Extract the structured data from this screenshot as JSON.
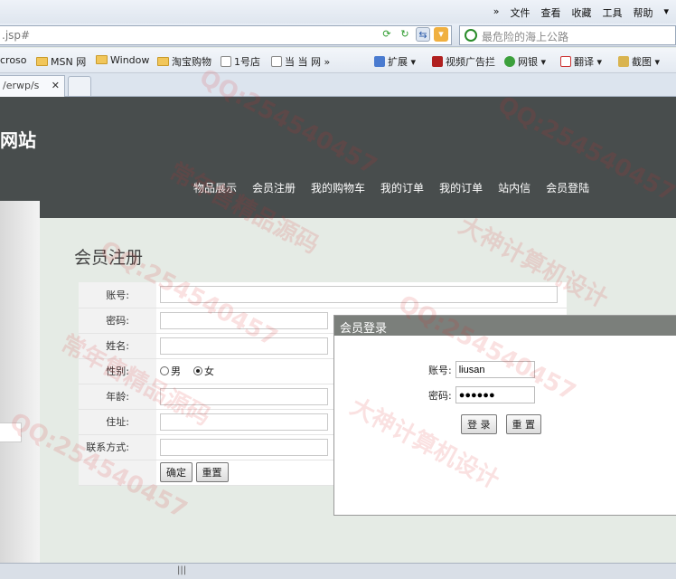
{
  "browser": {
    "menu": [
      "»",
      "文件",
      "查看",
      "收藏",
      "工具",
      "帮助"
    ],
    "url": ".jsp#",
    "search_placeholder": "最危险的海上公路",
    "favorites": [
      "crosо",
      "MSN 网",
      "Window",
      "淘宝购物",
      "1号店",
      "当 当 网 »"
    ],
    "favorites_tools": [
      "扩展 ▾",
      "视频广告拦",
      "网银 ▾",
      "翻译 ▾",
      "截图 ▾"
    ],
    "tab_title": "/erwp/s",
    "tab_close": "✕"
  },
  "site": {
    "title": "网站",
    "nav": [
      "物品展示",
      "会员注册",
      "我的购物车",
      "我的订单",
      "我的订单",
      "站内信",
      "会员登陆"
    ]
  },
  "register": {
    "heading": "会员注册",
    "fields": {
      "account": "账号:",
      "password": "密码:",
      "name": "姓名:",
      "gender": "性别:",
      "age": "年龄:",
      "address": "住址:",
      "contact": "联系方式:"
    },
    "gender_options": {
      "male": "男",
      "female": "女"
    },
    "gender_selected": "女",
    "submit": "确定",
    "reset": "重置"
  },
  "login": {
    "title": "会员登录",
    "account_label": "账号:",
    "account_value": "liusan",
    "password_label": "密码:",
    "password_value": "●●●●●●",
    "login_button": "登 录",
    "reset_button": "重 置"
  },
  "status": {
    "grip": "|||"
  },
  "watermark": {
    "phrases": [
      "常年售精品源码",
      "QQ:254540457",
      "大神计算机设计"
    ]
  },
  "colors": {
    "header": "#484d4d",
    "page_bg": "#e5ebe5",
    "login_title": "#7b7f7b"
  }
}
